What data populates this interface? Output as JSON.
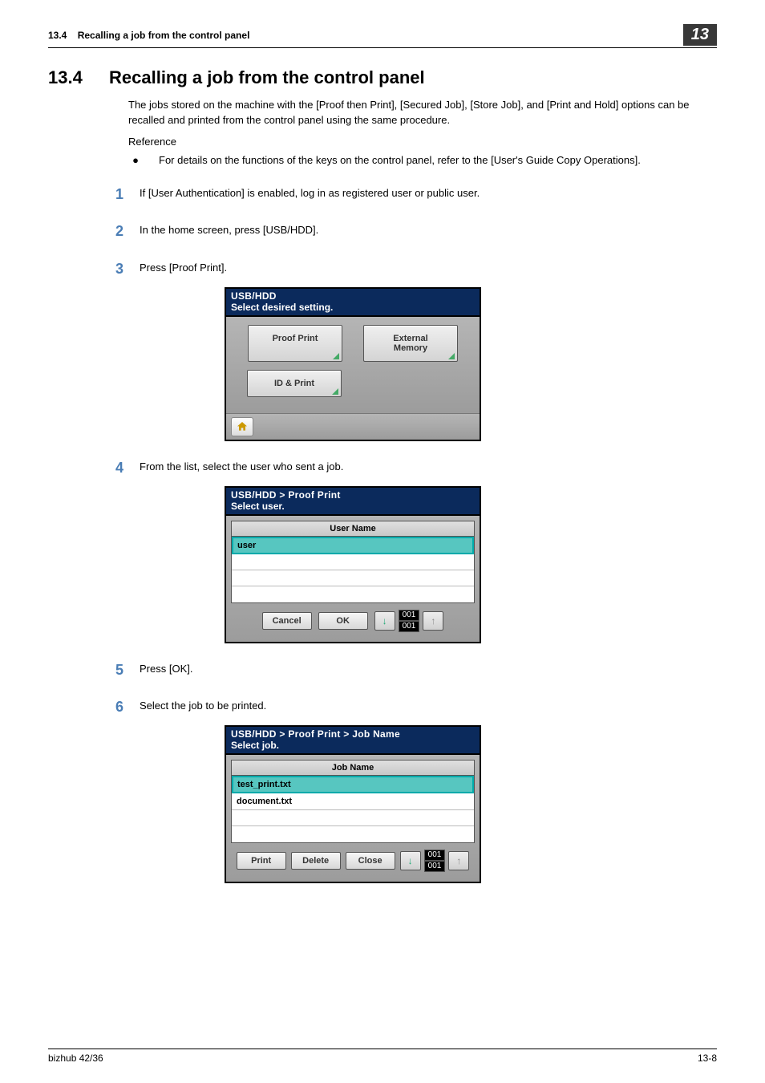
{
  "header": {
    "sectionRef": "13.4",
    "sectionTitle": "Recalling a job from the control panel",
    "chapterBadge": "13"
  },
  "section": {
    "num": "13.4",
    "title": "Recalling a job from the control panel"
  },
  "intro": "The jobs stored on the machine with the [Proof then Print], [Secured Job], [Store Job], and [Print and Hold] options can be recalled and printed from the control panel using the same procedure.",
  "referenceLabel": "Reference",
  "bullet1": "For details on the functions of the keys on the control panel, refer to the [User's Guide Copy Operations].",
  "steps": {
    "s1": "If [User Authentication] is enabled, log in as registered user or public user.",
    "s2": "In the home screen, press [USB/HDD].",
    "s3": "Press [Proof Print].",
    "s4": "From the list, select the user who sent a job.",
    "s5": "Press [OK].",
    "s6": "Select the job to be printed."
  },
  "panel1": {
    "title": "USB/HDD",
    "subtitle": "Select desired setting.",
    "btnProof": "Proof Print",
    "btnExt": "External\nMemory",
    "btnId": "ID & Print"
  },
  "panel2": {
    "title": "USB/HDD > Proof Print",
    "subtitle": "Select user.",
    "listHead": "User Name",
    "item1": "user",
    "btnCancel": "Cancel",
    "btnOK": "OK",
    "countTop": "001",
    "countBot": "001"
  },
  "panel3": {
    "title": "USB/HDD > Proof Print > Job Name",
    "subtitle": "Select job.",
    "listHead": "Job Name",
    "item1": "test_print.txt",
    "item2": "document.txt",
    "btnPrint": "Print",
    "btnDelete": "Delete",
    "btnClose": "Close",
    "countTop": "001",
    "countBot": "001"
  },
  "footer": {
    "left": "bizhub 42/36",
    "right": "13-8"
  }
}
